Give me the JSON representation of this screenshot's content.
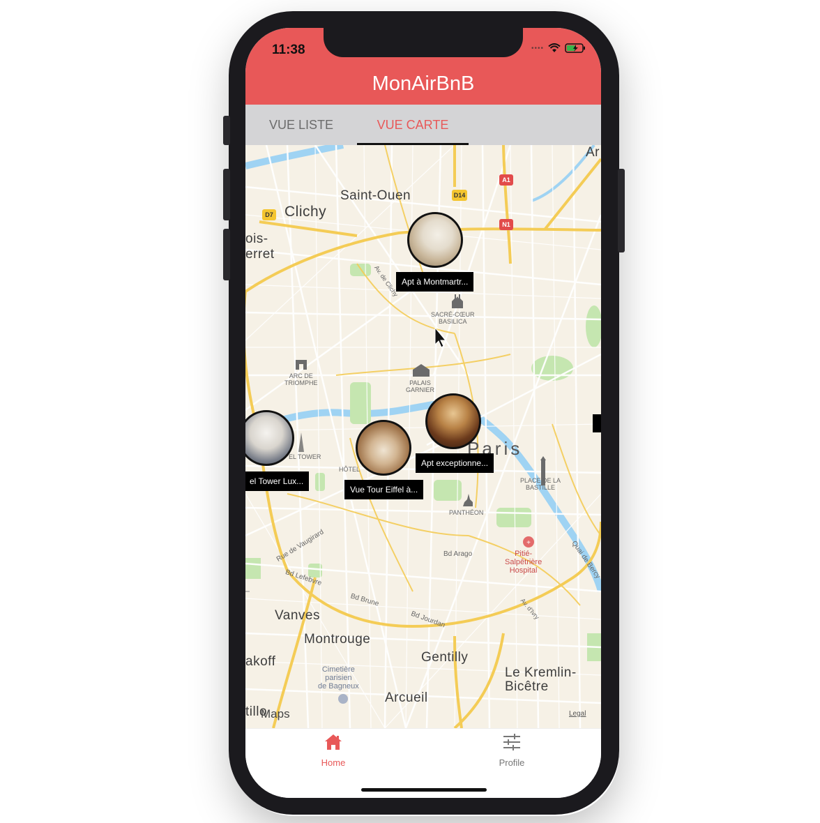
{
  "status_bar": {
    "time": "11:38"
  },
  "header": {
    "title": "MonAirBnB"
  },
  "tabs": [
    {
      "label": "VUE LISTE",
      "active": false
    },
    {
      "label": "VUE CARTE",
      "active": true
    }
  ],
  "map": {
    "cities": [
      "Saint-Ouen",
      "Clichy",
      "ois-",
      "erret",
      "Paris",
      "Vanves",
      "Montrouge",
      "Gentilly",
      "Arcueil",
      "Le Kremlin-",
      "Bicêtre",
      "akoff",
      "Ar",
      "tillo"
    ],
    "pois": [
      "SACRÉ-CŒUR\nBASILICA",
      "ARC DE\nTRIOMPHE",
      "PALAIS\nGARNIER",
      "PLACE DE LA\nBASTILLE",
      "PANTHÉON",
      "HÔTEL",
      "EL TOWER"
    ],
    "streets": [
      "Bd Arago",
      "Bd Lefebvre",
      "Bd Brune",
      "Bd Jourdan",
      "Rue de Vaugirard",
      "Quai de Bercy",
      "Av. d'Ivry",
      "Av. de Clichy"
    ],
    "hospital": "Pitié-\nSalpêtrière\nHospital",
    "cemetery": "Cimetière\nparisien\nde Bagneux",
    "road_shields": [
      "D14",
      "A1",
      "N1",
      "D7"
    ],
    "attribution": "Maps",
    "legal": "Legal",
    "colors": {
      "land": "#f6f1e6",
      "water": "#9fd3f3",
      "park": "#c5e6b0",
      "major_road": "#f4cc56",
      "minor_road": "#ffffff"
    }
  },
  "listings": [
    {
      "title": "Apt à Montmartr..."
    },
    {
      "title": "Apt exceptionne..."
    },
    {
      "title": "Vue Tour Eiffel à..."
    },
    {
      "title": "el Tower Lux..."
    }
  ],
  "bottom_nav": [
    {
      "label": "Home",
      "icon": "home-icon",
      "active": true
    },
    {
      "label": "Profile",
      "icon": "sliders-icon",
      "active": false
    }
  ],
  "colors": {
    "accent": "#e85858",
    "tab_bar": "#d4d4d6",
    "phone_body": "#1b1a1e"
  }
}
